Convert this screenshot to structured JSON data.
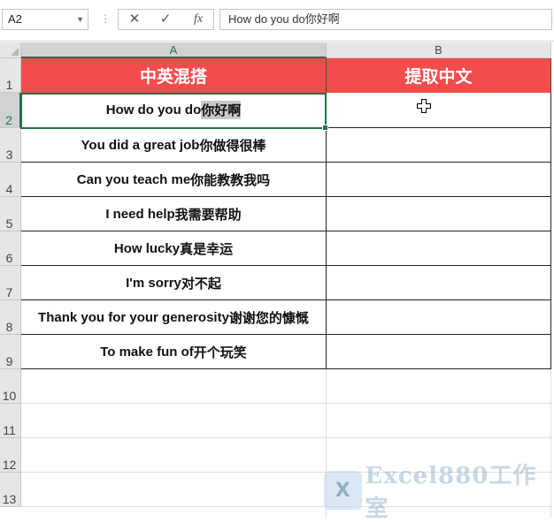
{
  "formula_bar": {
    "name_box": "A2",
    "cancel_icon": "✕",
    "enter_icon": "✓",
    "fx_label": "fx",
    "content": "How do you do你好啊"
  },
  "columns": [
    {
      "label": "A",
      "selected": true
    },
    {
      "label": "B",
      "selected": false
    }
  ],
  "rows": [
    "1",
    "2",
    "3",
    "4",
    "5",
    "6",
    "7",
    "8",
    "9",
    "10",
    "11",
    "12",
    "13"
  ],
  "header": {
    "col_a": "中英混搭",
    "col_b": "提取中文"
  },
  "data": [
    {
      "en": "How do you do",
      "zh": "你好啊",
      "b": ""
    },
    {
      "en": "You did a great job",
      "zh": "你做得很棒",
      "b": ""
    },
    {
      "en": "Can you teach me",
      "zh": "你能教教我吗",
      "b": ""
    },
    {
      "en": "I need help",
      "zh": "我需要帮助",
      "b": ""
    },
    {
      "en": "How lucky",
      "zh": "真是幸运",
      "b": ""
    },
    {
      "en": "I'm sorry",
      "zh": "对不起",
      "b": ""
    },
    {
      "en": "Thank you for your generosity",
      "zh": "谢谢您的慷慨",
      "b": ""
    },
    {
      "en": "To make fun of",
      "zh": "开个玩笑",
      "b": ""
    }
  ],
  "watermark": {
    "logo_text": "X",
    "text": "Excel880工作室"
  },
  "colors": {
    "header_fill": "#f24d4d",
    "selection": "#217346"
  }
}
